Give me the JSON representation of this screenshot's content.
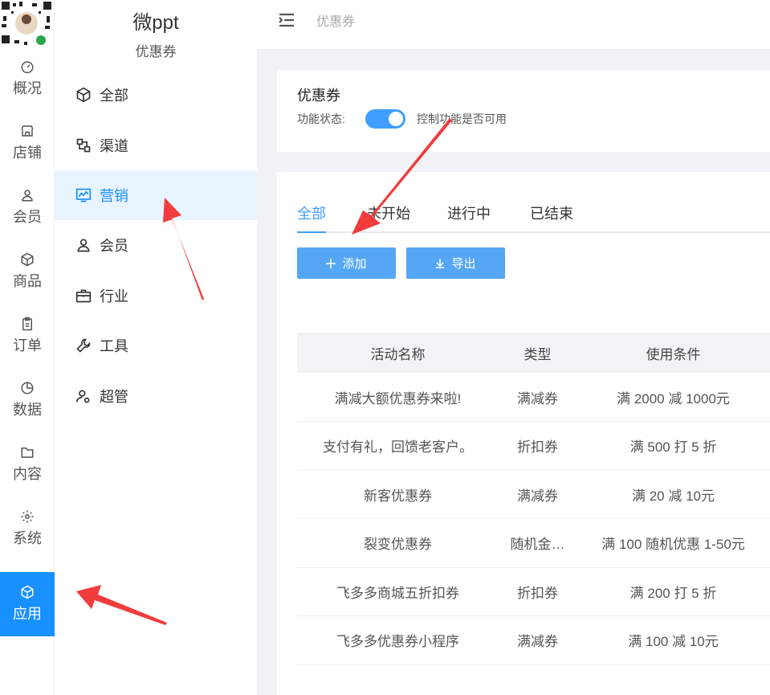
{
  "rail": [
    {
      "label": "概况",
      "icon": "dashboard-icon"
    },
    {
      "label": "店铺",
      "icon": "store-icon"
    },
    {
      "label": "会员",
      "icon": "user-icon"
    },
    {
      "label": "商品",
      "icon": "box-icon"
    },
    {
      "label": "订单",
      "icon": "clipboard-icon"
    },
    {
      "label": "数据",
      "icon": "pie-icon"
    },
    {
      "label": "内容",
      "icon": "folder-icon"
    },
    {
      "label": "系统",
      "icon": "gear-icon"
    },
    {
      "label": "应用",
      "icon": "cube-icon"
    }
  ],
  "brand": {
    "title": "微ppt",
    "subtitle": "优惠券"
  },
  "menu": [
    {
      "label": "全部",
      "icon": "cube-icon"
    },
    {
      "label": "渠道",
      "icon": "channel-icon"
    },
    {
      "label": "营销",
      "icon": "chart-icon"
    },
    {
      "label": "会员",
      "icon": "user-icon"
    },
    {
      "label": "行业",
      "icon": "briefcase-icon"
    },
    {
      "label": "工具",
      "icon": "wrench-icon"
    },
    {
      "label": "超管",
      "icon": "admin-icon"
    }
  ],
  "header": {
    "breadcrumb": "优惠券"
  },
  "settings": {
    "title": "优惠券",
    "status_label": "功能状态:",
    "status_on": true,
    "hint": "控制功能是否可用"
  },
  "tabs": [
    "全部",
    "未开始",
    "进行中",
    "已结束"
  ],
  "buttons": {
    "add": "添加",
    "export": "导出"
  },
  "table": {
    "headers": [
      "活动名称",
      "类型",
      "使用条件"
    ],
    "rows": [
      [
        "满减大额优惠券来啦!",
        "满减券",
        "满 2000 减 1000元"
      ],
      [
        "支付有礼，回馈老客户。",
        "折扣券",
        "满 500 打 5 折"
      ],
      [
        "新客优惠券",
        "满减券",
        "满 20 减 10元"
      ],
      [
        "裂变优惠券",
        "随机金…",
        "满 100 随机优惠 1-50元"
      ],
      [
        "飞多多商城五折扣券",
        "折扣券",
        "满 200 打 5 折"
      ],
      [
        "飞多多优惠券小程序",
        "满减券",
        "满 100 减 10元"
      ]
    ]
  },
  "colors": {
    "accent": "#409eff",
    "active_rail": "#1890ff",
    "annotation": "#f03c3c"
  }
}
